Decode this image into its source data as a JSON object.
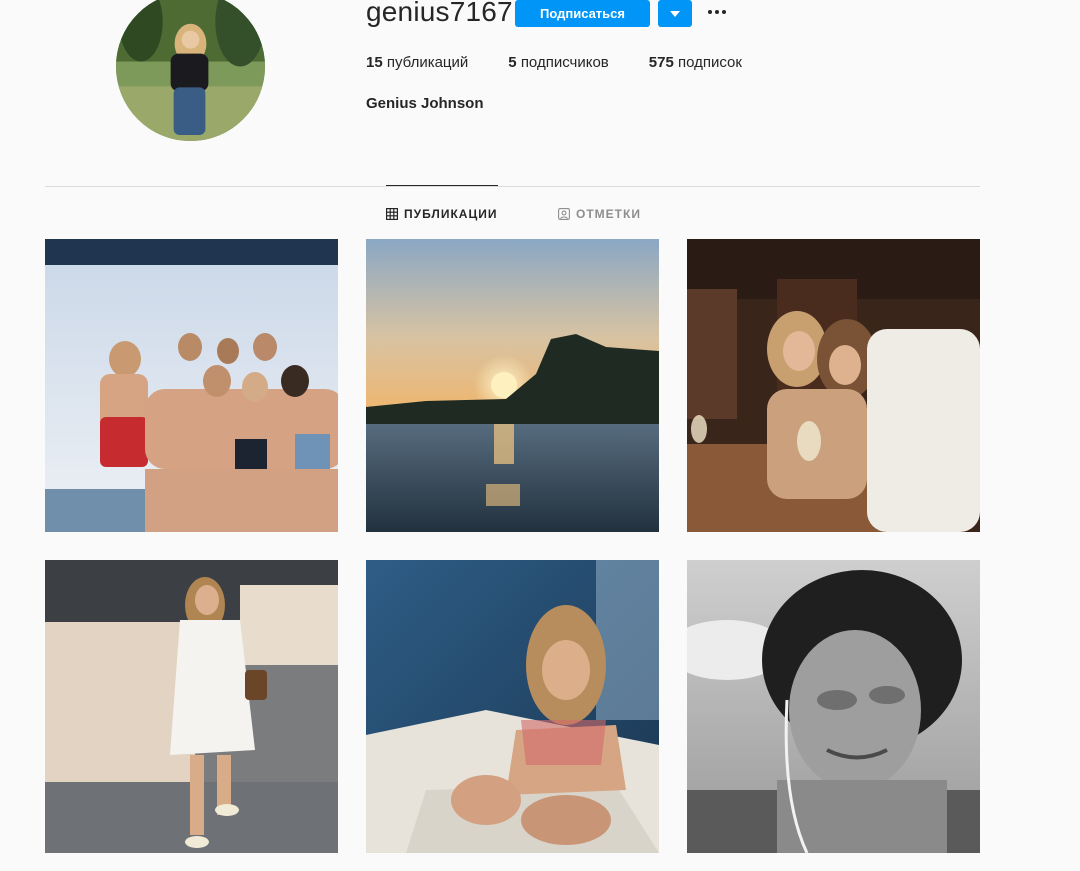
{
  "profile": {
    "username": "genius7167",
    "full_name": "Genius Johnson",
    "follow_label": "Подписаться",
    "dropdown_icon": "triangle-down-icon",
    "more_icon": "more-dots-icon",
    "accent_color": "#0095f6"
  },
  "stats": {
    "posts_count": "15",
    "posts_label": "публикаций",
    "followers_count": "5",
    "followers_label": "подписчиков",
    "following_count": "575",
    "following_label": "подписок"
  },
  "tabs": [
    {
      "label": "ПУБЛИКАЦИИ",
      "icon": "grid-icon",
      "active": true
    },
    {
      "label": "ОТМЕТКИ",
      "icon": "tagged-person-icon",
      "active": false
    }
  ]
}
